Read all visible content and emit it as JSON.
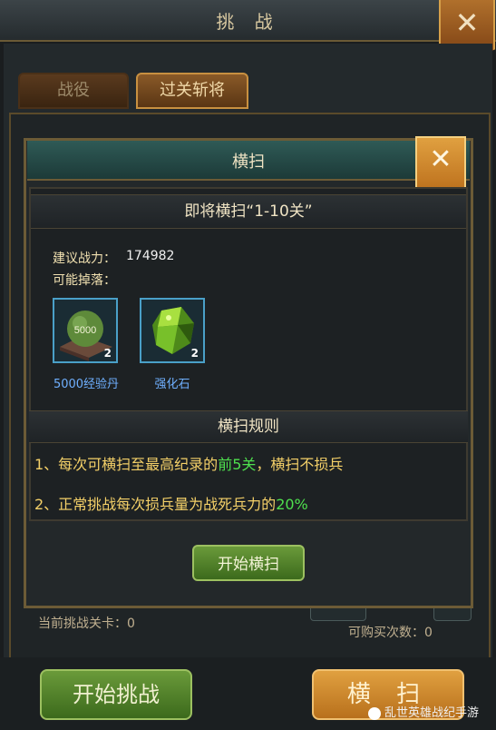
{
  "topbar": {
    "title": "挑 战"
  },
  "tabs": [
    {
      "label": "战役",
      "active": false
    },
    {
      "label": "过关斩将",
      "active": true
    }
  ],
  "background_panel": {
    "current_stage_label": "当前挑战关卡：0",
    "purchasable_label": "可购买次数：0"
  },
  "bottom_buttons": {
    "start_challenge": "开始挑战",
    "sweep": "横 扫"
  },
  "watermark": {
    "text": "乱世英雄战纪手游"
  },
  "dialog": {
    "title": "横扫",
    "header": "即将横扫“1-10关”",
    "recommended_power_label": "建议战力：",
    "recommended_power_value": "174982",
    "drops_label": "可能掉落：",
    "items": [
      {
        "name": "5000经验丹",
        "count": "2",
        "badge": "5000",
        "icon": "exp-pill-icon"
      },
      {
        "name": "强化石",
        "count": "2",
        "icon": "green-gem-icon"
      }
    ],
    "rules_header": "横扫规则",
    "rules": {
      "rule1_prefix": "1、每次可横扫至最高纪录的",
      "rule1_highlight": "前5关",
      "rule1_suffix": "，横扫不损兵",
      "rule2_prefix": "2、正常挑战每次损兵量为战死兵力的",
      "rule2_highlight": "20%"
    },
    "start_button": "开始横扫"
  },
  "colors": {
    "highlight_green": "#4ee04e",
    "rule_text": "#f4d068",
    "item_name": "#6fb0ff"
  }
}
